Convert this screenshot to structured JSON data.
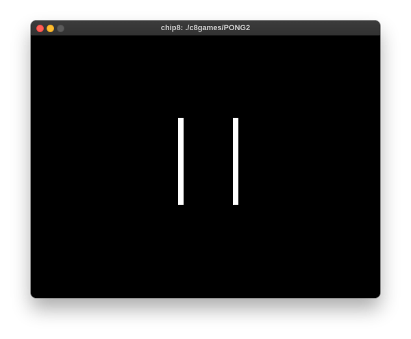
{
  "window": {
    "title": "chip8: ./c8games/PONG2"
  },
  "titlebar": {
    "buttons": [
      {
        "name": "close",
        "color": "#ff5f57"
      },
      {
        "name": "minimize",
        "color": "#febc2e"
      },
      {
        "name": "zoom",
        "color": "#5b5b5b"
      }
    ]
  },
  "screen": {
    "background": "#000000",
    "pixel_color": "#ffffff",
    "sprites": [
      "left-paddle",
      "right-paddle"
    ]
  }
}
